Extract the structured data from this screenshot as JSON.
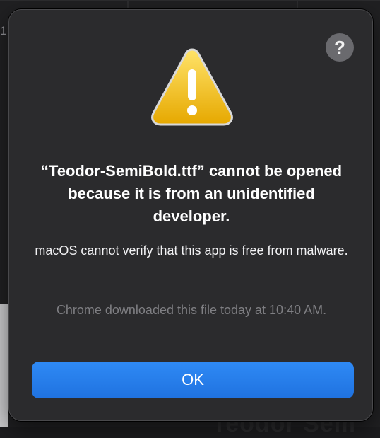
{
  "background": {
    "partial_number": "1",
    "partial_text": "Teodor Sem"
  },
  "dialog": {
    "help_label": "?",
    "icon": "warning-triangle-icon",
    "title": "“Teodor-SemiBold.ttf” cannot be opened because it is from an unidentified developer.",
    "message": "macOS cannot verify that this app is free from malware.",
    "note": "Chrome downloaded this file today at 10:40 AM.",
    "ok_label": "OK"
  },
  "colors": {
    "accent": "#1f72e0",
    "warning": "#f4c430",
    "dialog_bg": "#2b2b2d"
  }
}
